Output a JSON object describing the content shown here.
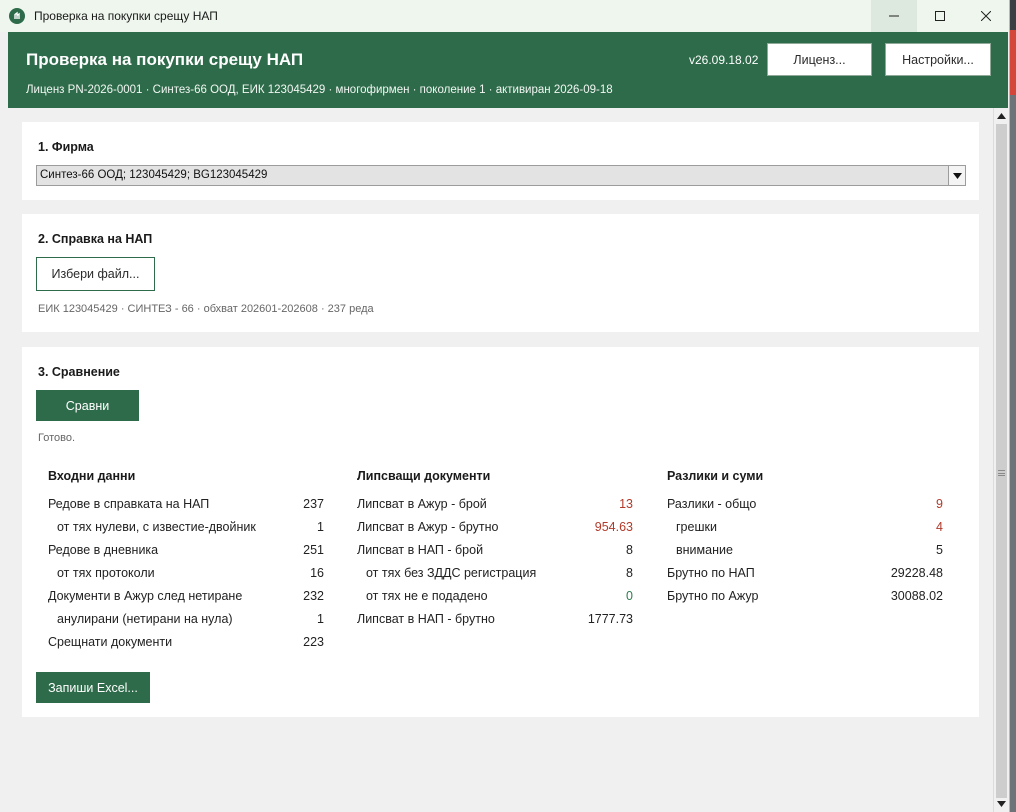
{
  "window": {
    "title": "Проверка на покупки срещу НАП",
    "icon": "app-logo-icon"
  },
  "header": {
    "title": "Проверка на покупки срещу НАП",
    "subtitle": "Лиценз PN-2026-0001 · Синтез-66 ООД, ЕИК 123045429 · многофирмен · поколение 1 · активиран 2026-09-18",
    "version": "v26.09.18.02",
    "license_button": "Лиценз...",
    "settings_button": "Настройки..."
  },
  "section1": {
    "title": "1. Фирма",
    "company_selected": "Синтез-66 ООД; 123045429; BG123045429"
  },
  "section2": {
    "title": "2. Справка на НАП",
    "choose_file_button": "Избери файл...",
    "file_info": "ЕИК 123045429 · СИНТЕЗ - 66 · обхват 202601-202608 · 237 реда"
  },
  "section3": {
    "title": "3. Сравнение",
    "compare_button": "Сравни",
    "status": "Готово.",
    "save_excel_button": "Запиши Excel...",
    "columns": [
      {
        "heading": "Входни данни",
        "rows": [
          {
            "label": "Редове в справката на НАП",
            "value": "237",
            "sub": false,
            "tone": "normal"
          },
          {
            "label": "от тях нулеви, с известие-двойник",
            "value": "1",
            "sub": true,
            "tone": "normal"
          },
          {
            "label": "Редове в дневника",
            "value": "251",
            "sub": false,
            "tone": "normal"
          },
          {
            "label": "от тях протоколи",
            "value": "16",
            "sub": true,
            "tone": "normal"
          },
          {
            "label": "Документи в Ажур след нетиране",
            "value": "232",
            "sub": false,
            "tone": "normal"
          },
          {
            "label": "анулирани (нетирани на нула)",
            "value": "1",
            "sub": true,
            "tone": "normal"
          },
          {
            "label": "Срещнати документи",
            "value": "223",
            "sub": false,
            "tone": "normal"
          }
        ]
      },
      {
        "heading": "Липсващи документи",
        "rows": [
          {
            "label": "Липсват в Ажур - брой",
            "value": "13",
            "sub": false,
            "tone": "red"
          },
          {
            "label": "Липсват в Ажур - брутно",
            "value": "954.63",
            "sub": false,
            "tone": "red"
          },
          {
            "label": "Липсват в НАП - брой",
            "value": "8",
            "sub": false,
            "tone": "normal"
          },
          {
            "label": "от тях без ЗДДС регистрация",
            "value": "8",
            "sub": true,
            "tone": "normal"
          },
          {
            "label": "от тях не е подадено",
            "value": "0",
            "sub": true,
            "tone": "green"
          },
          {
            "label": "Липсват в НАП - брутно",
            "value": "1777.73",
            "sub": false,
            "tone": "normal"
          }
        ]
      },
      {
        "heading": "Разлики и суми",
        "rows": [
          {
            "label": "Разлики - общо",
            "value": "9",
            "sub": false,
            "tone": "red"
          },
          {
            "label": "грешки",
            "value": "4",
            "sub": true,
            "tone": "red"
          },
          {
            "label": "внимание",
            "value": "5",
            "sub": true,
            "tone": "normal"
          },
          {
            "label": "Брутно по НАП",
            "value": "29228.48",
            "sub": false,
            "tone": "normal"
          },
          {
            "label": "Брутно по Ажур",
            "value": "30088.02",
            "sub": false,
            "tone": "normal"
          }
        ]
      }
    ]
  },
  "colors": {
    "brand_green": "#2e6b4a",
    "value_red": "#b13a2a",
    "value_green": "#2e7d4f"
  }
}
